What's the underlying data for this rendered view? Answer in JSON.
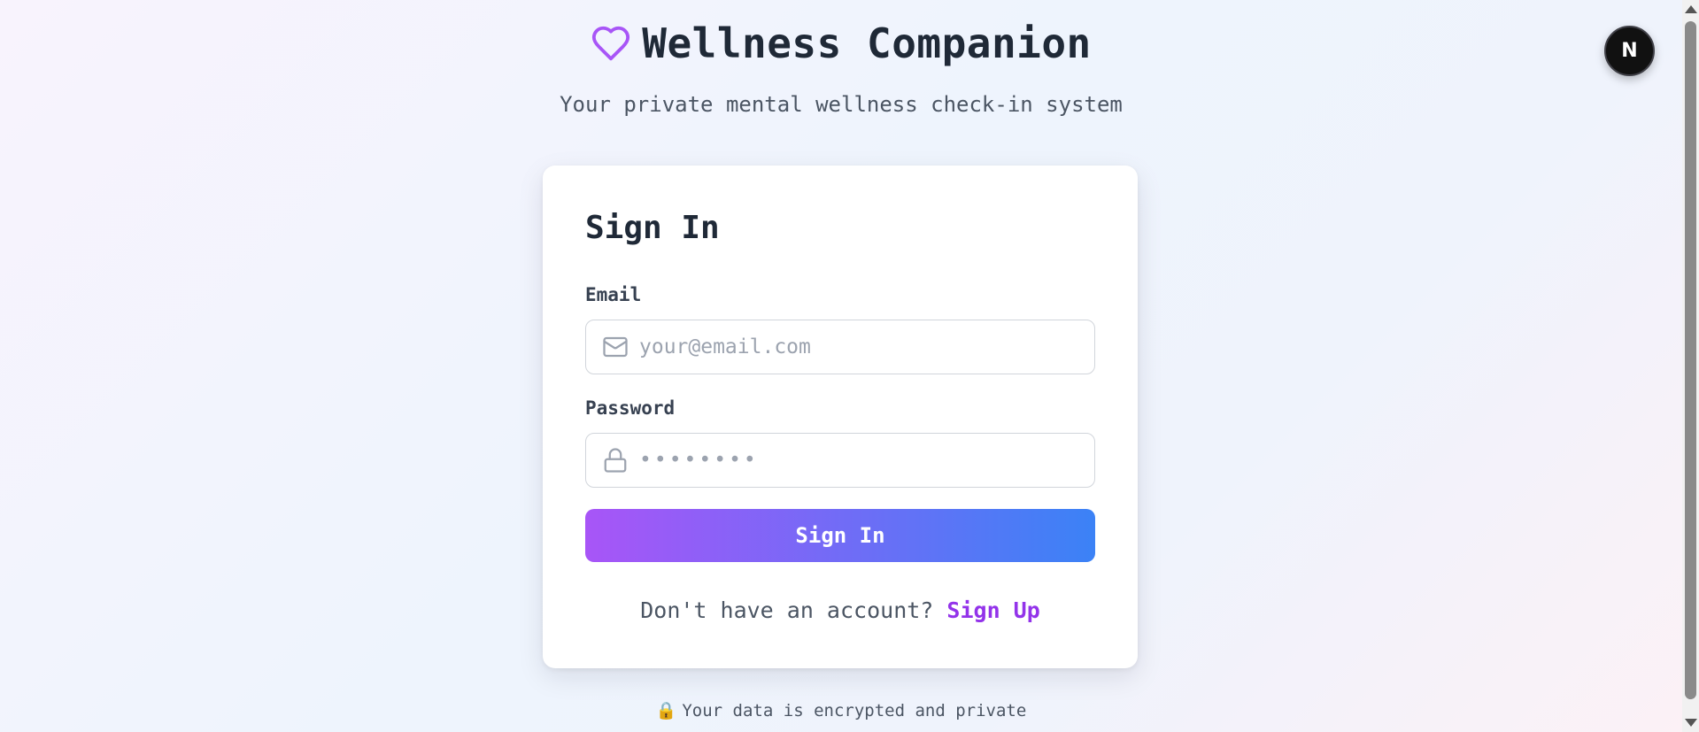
{
  "header": {
    "title": "Wellness Companion",
    "subtitle": "Your private mental wellness check-in system",
    "logo_icon": "heart-icon",
    "accent_color": "#a855f7"
  },
  "form": {
    "title": "Sign In",
    "email": {
      "label": "Email",
      "placeholder": "your@email.com",
      "value": "",
      "icon": "mail-icon"
    },
    "password": {
      "label": "Password",
      "placeholder": "••••••••",
      "value": "",
      "icon": "lock-icon"
    },
    "submit_label": "Sign In",
    "button_gradient": [
      "#a855f7",
      "#3b82f6"
    ],
    "signup_prompt": "Don't have an account?",
    "signup_link": "Sign Up"
  },
  "footer": {
    "lock_emoji": "🔒",
    "note": "Your data is encrypted and private"
  },
  "avatar": {
    "letter": "N"
  }
}
